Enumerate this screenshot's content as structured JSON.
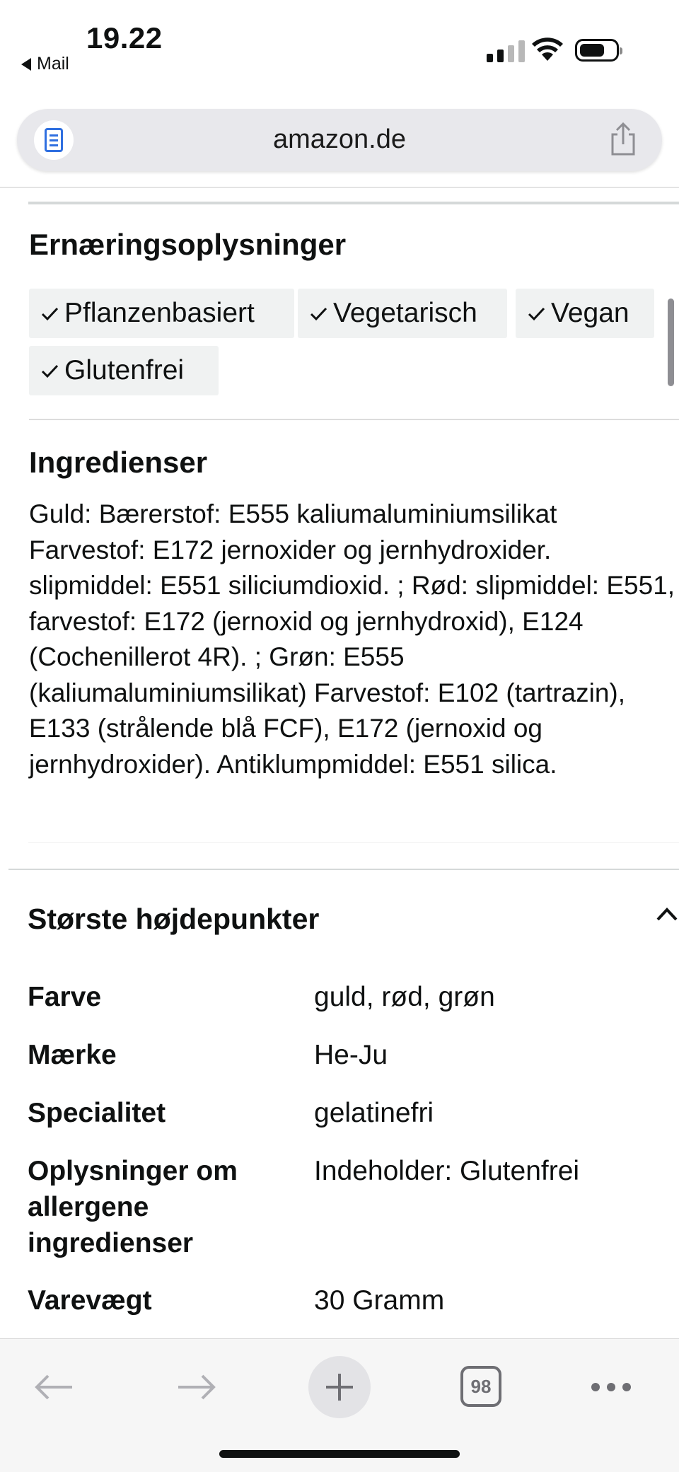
{
  "status_bar": {
    "time": "19.22",
    "back_app": "Mail"
  },
  "browser": {
    "url": "amazon.de",
    "tab_count": "98"
  },
  "nutrition": {
    "heading": "Ernæringsoplysninger",
    "tags": [
      "Pflanzenbasiert",
      "Vegetarisch",
      "Vegan",
      "Glutenfrei"
    ]
  },
  "ingredients": {
    "heading": "Ingredienser",
    "text": "Guld: Bærerstof: E555 kaliumaluminiumsilikat Farvestof: E172 jernoxider og jernhydroxider. slipmiddel: E551 siliciumdioxid. ; Rød: slipmiddel: E551, farvestof: E172 (jernoxid og jernhydroxid), E124 (Cochenillerot 4R). ; Grøn: E555 (kaliumaluminiumsilikat) Farvestof: E102 (tartrazin), E133 (strålende blå FCF), E172 (jernoxid og jernhydroxider). Antiklumpmiddel: E551 silica."
  },
  "highlights": {
    "heading": "Største højdepunkter",
    "rows": [
      {
        "label": "Farve",
        "value": "guld, rød, grøn"
      },
      {
        "label": "Mærke",
        "value": "He-Ju"
      },
      {
        "label": "Specialitet",
        "value": "gelatinefri"
      },
      {
        "label": "Oplysninger om allergene ingredienser",
        "value": "Indeholder: Glutenfrei"
      },
      {
        "label": "Varevægt",
        "value": "30 Gramm"
      }
    ]
  },
  "icons": {
    "reader": "reader-mode-icon",
    "share": "share-icon",
    "check": "checkmark-icon",
    "chevron": "chevron-up-icon",
    "back": "arrow-left-icon",
    "forward": "arrow-right-icon",
    "new_tab": "plus-icon",
    "more": "more-dots-icon"
  },
  "colors": {
    "reader_accent": "#2f6fe0",
    "tag_background": "#f0f2f2",
    "toolbar_icon": "#8e8e93"
  }
}
